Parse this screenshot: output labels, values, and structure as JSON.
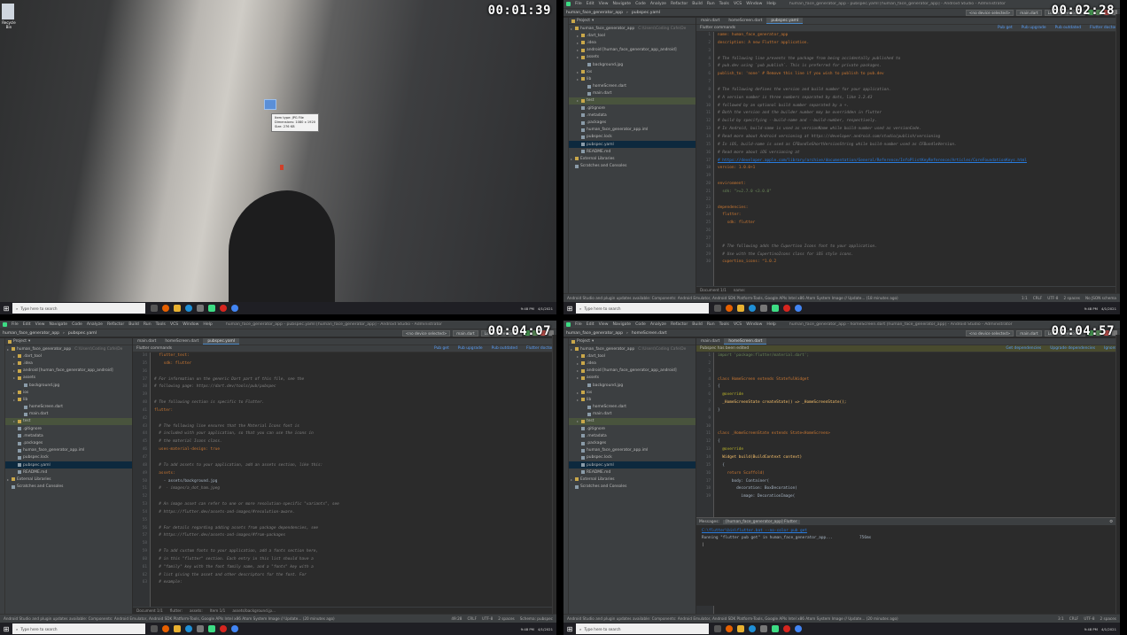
{
  "timestamps": [
    "00:01:39",
    "00:02:28",
    "00:04:07",
    "00:04:57"
  ],
  "desktop": {
    "icon_label": "Recycle Bin",
    "tooltip_lines": [
      "Item type: JPG File",
      "Dimensions: 1080 x 1920",
      "Size: 276 KB"
    ]
  },
  "taskbar": {
    "search_placeholder": "Type here to search",
    "clock": "9:48 PM",
    "date": "4/1/2021"
  },
  "ide_menu": [
    "File",
    "Edit",
    "View",
    "Navigate",
    "Code",
    "Analyze",
    "Refactor",
    "Build",
    "Run",
    "Tools",
    "VCS",
    "Window",
    "Help"
  ],
  "ide2": {
    "window_title": "human_face_generator_app - pubspec.yaml [human_face_generator_app] - Android Studio - Administrator",
    "breadcrumb_project": "human_face_generator_app",
    "breadcrumb_file": "pubspec.yaml",
    "device": "<no device selected>",
    "run_config": "main.dart",
    "loading": "Loading Devices...",
    "project_label": "Project",
    "tabs": [
      "main.dart",
      "homeScreen.dart",
      "pubspec.yaml"
    ],
    "flutter_commands": "Flutter commands",
    "actions": [
      "Pub get",
      "Pub upgrade",
      "Pub outdated",
      "Flutter doctor"
    ],
    "tree": [
      {
        "t": "human_face_generator_app",
        "d": 0,
        "k": "folder",
        "extra": "C:\\Users\\Coding Cafe\\De"
      },
      {
        "t": ".dart_tool",
        "d": 1,
        "k": "folder"
      },
      {
        "t": ".idea",
        "d": 1,
        "k": "folder"
      },
      {
        "t": "android [human_face_generator_app_android]",
        "d": 1,
        "k": "folder"
      },
      {
        "t": "assets",
        "d": 1,
        "k": "folder"
      },
      {
        "t": "background.jpg",
        "d": 2,
        "k": "file"
      },
      {
        "t": "ios",
        "d": 1,
        "k": "folder"
      },
      {
        "t": "lib",
        "d": 1,
        "k": "folder"
      },
      {
        "t": "homeScreen.dart",
        "d": 2,
        "k": "file"
      },
      {
        "t": "main.dart",
        "d": 2,
        "k": "file"
      },
      {
        "t": "test",
        "d": 1,
        "k": "folder",
        "mark": true
      },
      {
        "t": ".gitignore",
        "d": 1,
        "k": "file"
      },
      {
        "t": ".metadata",
        "d": 1,
        "k": "file"
      },
      {
        "t": ".packages",
        "d": 1,
        "k": "file"
      },
      {
        "t": "human_face_generator_app.iml",
        "d": 1,
        "k": "file"
      },
      {
        "t": "pubspec.lock",
        "d": 1,
        "k": "file"
      },
      {
        "t": "pubspec.yaml",
        "d": 1,
        "k": "file",
        "sel": true
      },
      {
        "t": "README.md",
        "d": 1,
        "k": "file"
      },
      {
        "t": "External Libraries",
        "d": 0,
        "k": "folder"
      },
      {
        "t": "Scratches and Consoles",
        "d": 0,
        "k": "file"
      }
    ],
    "code": [
      [
        "name: human_face_generator_app",
        "key"
      ],
      [
        "description: A new Flutter application.",
        "key"
      ],
      [
        "",
        ""
      ],
      [
        "# The following line prevents the package from being accidentally published to",
        "com"
      ],
      [
        "# pub.dev using `pub publish`. This is preferred for private packages.",
        "com"
      ],
      [
        "publish_to: 'none' # Remove this line if you wish to publish to pub.dev",
        "key"
      ],
      [
        "",
        ""
      ],
      [
        "# The following defines the version and build number for your application.",
        "com"
      ],
      [
        "# A version number is three numbers separated by dots, like 1.2.43",
        "com"
      ],
      [
        "# followed by an optional build number separated by a +.",
        "com"
      ],
      [
        "# Both the version and the builder number may be overridden in flutter",
        "com"
      ],
      [
        "# build by specifying --build-name and --build-number, respectively.",
        "com"
      ],
      [
        "# In Android, build-name is used as versionName while build-number used as versionCode.",
        "com"
      ],
      [
        "# Read more about Android versioning at https://developer.android.com/studio/publish/versioning",
        "com"
      ],
      [
        "# In iOS, build-name is used as CFBundleShortVersionString while build-number used as CFBundleVersion.",
        "com"
      ],
      [
        "# Read more about iOS versioning at",
        "com"
      ],
      [
        "# https://developer.apple.com/library/archive/documentation/General/Reference/InfoPlistKeyReference/Articles/CoreFoundationKeys.html",
        "url"
      ],
      [
        "version: 1.0.0+1",
        "key"
      ],
      [
        "",
        ""
      ],
      [
        "environment:",
        "key"
      ],
      [
        "  sdk: \">=2.7.0 <3.0.0\"",
        "str"
      ],
      [
        "",
        ""
      ],
      [
        "dependencies:",
        "key"
      ],
      [
        "  flutter:",
        "key"
      ],
      [
        "    sdk: flutter",
        "key"
      ],
      [
        "",
        ""
      ],
      [
        "",
        ""
      ],
      [
        "  # The following adds the Cupertino Icons font to your application.",
        "com"
      ],
      [
        "  # Use with the CupertinoIcons class for iOS style icons.",
        "com"
      ],
      [
        "  cupertino_icons: ^1.0.2",
        "key"
      ]
    ],
    "crumbs": [
      "Document 1/1",
      "name:"
    ],
    "tool_windows": [
      "6: Logcat",
      "Profiler",
      "Database Inspector",
      "TODO",
      "Terminal",
      "Dart Analysis"
    ],
    "tool_windows_right": [
      "Layout Inspector",
      "Event Log"
    ],
    "status": "Android Studio and plugin updates available: Components: Android Emulator, Android SDK Platform-Tools, Google APIs Intel x86 Atom System Image // Update... (18 minutes ago)",
    "status_right": [
      "1:1",
      "CRLF",
      "UTF-8",
      "2 spaces",
      "No JSON schema"
    ]
  },
  "ide3": {
    "window_title": "human_face_generator_app - pubspec.yaml [human_face_generator_app] - Android Studio - Administrator",
    "breadcrumb_project": "human_face_generator_app",
    "breadcrumb_file": "pubspec.yaml",
    "device": "<no device selected>",
    "run_config": "main.dart",
    "loading": "Loading Devices...",
    "project_label": "Project",
    "tabs": [
      "main.dart",
      "homeScreen.dart",
      "pubspec.yaml"
    ],
    "flutter_commands": "Flutter commands",
    "actions": [
      "Pub get",
      "Pub upgrade",
      "Pub outdated",
      "Flutter doctor"
    ],
    "code": [
      [
        "  flutter_test:",
        "key"
      ],
      [
        "    sdk: flutter",
        "key"
      ],
      [
        "",
        ""
      ],
      [
        "# For information on the generic Dart part of this file, see the",
        "com"
      ],
      [
        "# following page: https://dart.dev/tools/pub/pubspec",
        "com"
      ],
      [
        "",
        ""
      ],
      [
        "# The following section is specific to Flutter.",
        "com"
      ],
      [
        "flutter:",
        "key"
      ],
      [
        "",
        ""
      ],
      [
        "  # The following line ensures that the Material Icons font is",
        "com"
      ],
      [
        "  # included with your application, so that you can use the icons in",
        "com"
      ],
      [
        "  # the material Icons class.",
        "com"
      ],
      [
        "  uses-material-design: true",
        "key"
      ],
      [
        "",
        ""
      ],
      [
        "  # To add assets to your application, add an assets section, like this:",
        "com"
      ],
      [
        "  assets:",
        "key"
      ],
      [
        "    - assets/background.jpg",
        "cls"
      ],
      [
        "  #  - images/a_dot_ham.jpeg",
        "com"
      ],
      [
        "",
        ""
      ],
      [
        "  # An image asset can refer to one or more resolution-specific \"variants\", see",
        "com"
      ],
      [
        "  # https://flutter.dev/assets-and-images/#resolution-aware.",
        "com"
      ],
      [
        "",
        ""
      ],
      [
        "  # For details regarding adding assets from package dependencies, see",
        "com"
      ],
      [
        "  # https://flutter.dev/assets-and-images/#from-packages",
        "com"
      ],
      [
        "",
        ""
      ],
      [
        "  # To add custom fonts to your application, add a fonts section here,",
        "com"
      ],
      [
        "  # in this \"flutter\" section. Each entry in this list should have a",
        "com"
      ],
      [
        "  # \"family\" key with the font family name, and a \"fonts\" key with a",
        "com"
      ],
      [
        "  # list giving the asset and other descriptors for the font. For",
        "com"
      ],
      [
        "  # example:",
        "com"
      ]
    ],
    "crumbs": [
      "Document 1/1",
      "flutter:",
      "assets:",
      "Item 1/1",
      "assets/background.jp..."
    ],
    "tool_windows": [
      "6: Logcat",
      "Profiler",
      "Database Inspector",
      "TODO",
      "Terminal",
      "Dart Analysis"
    ],
    "tool_windows_right": [
      "Layout Inspector",
      "Event Log"
    ],
    "status": "Android Studio and plugin updates available: Components: Android Emulator, Android SDK Platform-Tools, Google APIs Intel x86 Atom System Image // Update... (20 minutes ago)",
    "status_right": [
      "49:28",
      "CRLF",
      "UTF-8",
      "2 spaces",
      "Schema: pubspec"
    ]
  },
  "ide4": {
    "window_title": "human_face_generator_app - homeScreen.dart [human_face_generator_app] - Android Studio - Administrator",
    "breadcrumb_project": "human_face_generator_app",
    "breadcrumb_file": "homeScreen.dart",
    "device": "<no device selected>",
    "run_config": "main.dart",
    "loading": "Loading Devices...",
    "project_label": "Project",
    "tabs": [
      "main.dart",
      "homeScreen.dart"
    ],
    "banner": "Pubspec has been edited",
    "banner_actions": [
      "Get dependencies",
      "Upgrade dependencies",
      "Ignore"
    ],
    "code": [
      [
        "import 'package:flutter/material.dart';",
        "str"
      ],
      [
        "",
        ""
      ],
      [
        "",
        ""
      ],
      [
        "class HomeScreen extends StatefulWidget",
        "key"
      ],
      [
        "{",
        ""
      ],
      [
        "  @override",
        "anno"
      ],
      [
        "  _HomeScreenState createState() => _HomeScreenState();",
        "fn"
      ],
      [
        "}",
        ""
      ],
      [
        "",
        ""
      ],
      [
        "",
        ""
      ],
      [
        "class _HomeScreenState extends State<HomeScreen>",
        "key"
      ],
      [
        "{",
        ""
      ],
      [
        "  @override",
        "anno"
      ],
      [
        "  Widget build(BuildContext context)",
        "fn"
      ],
      [
        "  {",
        ""
      ],
      [
        "    return Scaffold(",
        "key"
      ],
      [
        "      body: Container(",
        "cls"
      ],
      [
        "        decoration: BoxDecoration(",
        "cls"
      ],
      [
        "          image: DecorationImage(",
        "cls"
      ]
    ],
    "messages_label": "Messages:",
    "messages_tab": "[human_face_generator_app] Flutter",
    "console": [
      "C:\\flutter\\bin\\flutter.bat --no-color pub get",
      "Running \"flutter pub get\" in human_face_generator_app...",
      "756ms"
    ],
    "tool_windows": [
      "6: Logcat",
      "Profiler",
      "Database Inspector",
      "TODO",
      "Terminal",
      "Dart Analysis",
      "0: Messages"
    ],
    "tool_windows_right": [
      "Layout Inspector",
      "Event Log"
    ],
    "status": "Android Studio and plugin updates available: Components: Android Emulator, Android SDK Platform-Tools, Google APIs Intel x86 Atom System Image // Update... (20 minutes ago)",
    "status_right": [
      "3:1",
      "CRLF",
      "UTF-8",
      "2 spaces"
    ]
  },
  "colors": {
    "ide_bg": "#2b2b2b",
    "panel_bg": "#3c3f41",
    "selection": "#0d293e",
    "link": "#589df6"
  }
}
